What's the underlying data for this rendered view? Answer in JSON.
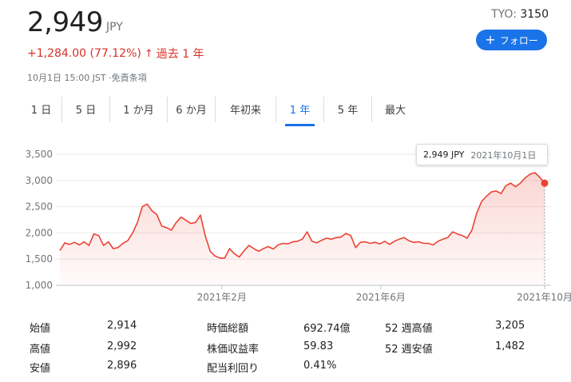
{
  "quote": {
    "price": "2,949",
    "currency": "JPY",
    "exchange": "TYO:",
    "symbol": "3150",
    "change": "+1,284.00 (77.12%)",
    "change_arrow": "↑",
    "period_label": "過去 1 年",
    "timestamp": "10月1日 15:00 JST ·免責条項"
  },
  "follow_button": {
    "label": "フォロー",
    "icon": "plus-icon"
  },
  "tabs": [
    {
      "label": "1 日",
      "active": false
    },
    {
      "label": "5 日",
      "active": false
    },
    {
      "label": "1 か月",
      "active": false
    },
    {
      "label": "6 か月",
      "active": false
    },
    {
      "label": "年初来",
      "active": false
    },
    {
      "label": "1 年",
      "active": true
    },
    {
      "label": "5 年",
      "active": false
    },
    {
      "label": "最大",
      "active": false
    }
  ],
  "tooltip": {
    "value": "2,949 JPY",
    "date": "2021年10月1日"
  },
  "colors": {
    "line": "#ea4335",
    "accent": "#1a73e8",
    "up": "#d93025",
    "grid": "#e8eaed"
  },
  "chart_data": {
    "type": "area",
    "ylim": [
      1000,
      3500
    ],
    "yticks": [
      "3,500",
      "3,000",
      "2,500",
      "2,000",
      "1,500",
      "1,000"
    ],
    "ytick_values": [
      3500,
      3000,
      2500,
      2000,
      1500,
      1000
    ],
    "xticks": [
      {
        "label": "2021年2月",
        "t": 0.334
      },
      {
        "label": "2021年6月",
        "t": 0.662
      },
      {
        "label": "2021年10月",
        "t": 1.0
      }
    ],
    "series": [
      {
        "x": [
          0,
          0.01,
          0.02,
          0.03,
          0.04,
          0.05,
          0.06,
          0.07,
          0.08,
          0.09,
          0.1,
          0.11,
          0.12,
          0.13,
          0.14,
          0.15,
          0.16,
          0.17,
          0.18,
          0.19,
          0.2,
          0.21,
          0.22,
          0.23,
          0.24,
          0.25,
          0.26,
          0.27,
          0.28,
          0.29,
          0.3,
          0.31,
          0.32,
          0.33,
          0.34,
          0.35,
          0.36,
          0.37,
          0.38,
          0.39,
          0.4,
          0.41,
          0.42,
          0.43,
          0.44,
          0.45,
          0.46,
          0.47,
          0.48,
          0.49,
          0.5,
          0.51,
          0.52,
          0.53,
          0.54,
          0.55,
          0.56,
          0.57,
          0.58,
          0.59,
          0.6,
          0.61,
          0.62,
          0.63,
          0.64,
          0.65,
          0.66,
          0.67,
          0.68,
          0.69,
          0.7,
          0.71,
          0.72,
          0.73,
          0.74,
          0.75,
          0.76,
          0.77,
          0.78,
          0.79,
          0.8,
          0.81,
          0.82,
          0.83,
          0.84,
          0.85,
          0.86,
          0.87,
          0.88,
          0.89,
          0.9,
          0.91,
          0.92,
          0.93,
          0.94,
          0.95,
          0.96,
          0.97,
          0.98,
          0.99,
          1.0
        ],
        "values": [
          1665,
          1810,
          1780,
          1820,
          1770,
          1830,
          1760,
          1980,
          1950,
          1760,
          1830,
          1700,
          1720,
          1800,
          1850,
          2000,
          2200,
          2500,
          2550,
          2420,
          2350,
          2130,
          2100,
          2050,
          2200,
          2300,
          2240,
          2180,
          2200,
          2340,
          1940,
          1650,
          1560,
          1520,
          1520,
          1700,
          1600,
          1540,
          1660,
          1760,
          1700,
          1650,
          1700,
          1740,
          1690,
          1770,
          1800,
          1790,
          1830,
          1840,
          1880,
          2020,
          1840,
          1810,
          1860,
          1900,
          1880,
          1910,
          1920,
          1990,
          1950,
          1720,
          1820,
          1830,
          1800,
          1820,
          1790,
          1840,
          1780,
          1840,
          1880,
          1910,
          1850,
          1820,
          1830,
          1800,
          1800,
          1770,
          1840,
          1880,
          1910,
          2020,
          1980,
          1950,
          1900,
          2050,
          2380,
          2600,
          2700,
          2780,
          2800,
          2750,
          2900,
          2950,
          2880,
          2950,
          3050,
          3120,
          3150,
          3060,
          2949
        ]
      }
    ],
    "last_value": 2949
  },
  "stats": [
    {
      "label": "始値",
      "value": "2,914"
    },
    {
      "label": "高値",
      "value": "2,992"
    },
    {
      "label": "安値",
      "value": "2,896"
    },
    {
      "label": "時価総額",
      "value": "692.74億"
    },
    {
      "label": "株価収益率",
      "value": "59.83"
    },
    {
      "label": "配当利回り",
      "value": "0.41%"
    },
    {
      "label": "52 週高値",
      "value": "3,205"
    },
    {
      "label": "52 週安値",
      "value": "1,482"
    }
  ]
}
